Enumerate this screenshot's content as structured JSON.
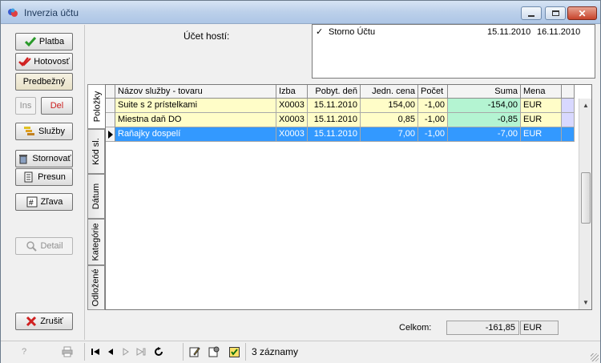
{
  "window": {
    "title": "Inverzia účtu"
  },
  "buttons": {
    "platba": "Platba",
    "hotovost": "Hotovosť",
    "predbezny": "Predbežný",
    "ins": "Ins",
    "del": "Del",
    "sluzby": "Služby",
    "stornovat": "Stornovať",
    "presun": "Presun",
    "zlava": "Zľava",
    "detail": "Detail",
    "zrusit": "Zrušiť"
  },
  "info": {
    "label": "Účet hostí:",
    "entry": {
      "text": "Storno Účtu",
      "date_from": "15.11.2010",
      "date_to": "16.11.2010"
    }
  },
  "tabs": [
    "Položky",
    "Kód sl.",
    "Dátum",
    "Kategórie",
    "Odložené"
  ],
  "grid": {
    "columns": [
      "Názov služby - tovaru",
      "Izba",
      "Pobyt. deň",
      "Jedn. cena",
      "Počet",
      "Suma",
      "Mena"
    ],
    "rows": [
      [
        "Suite s 2 prístelkami",
        "X0003",
        "15.11.2010",
        "154,00",
        "-1,00",
        "-154,00",
        "EUR"
      ],
      [
        "Miestna daň DO",
        "X0003",
        "15.11.2010",
        "0,85",
        "-1,00",
        "-0,85",
        "EUR"
      ],
      [
        "Raňajky dospelí",
        "X0003",
        "15.11.2010",
        "7,00",
        "-1,00",
        "-7,00",
        "EUR"
      ]
    ],
    "selected_row": 2
  },
  "total": {
    "label": "Celkom:",
    "value": "-161,85",
    "currency": "EUR"
  },
  "status": {
    "count_text": "3 záznamy"
  },
  "colors": {
    "row_yellow": "#fffdc8",
    "sum_green": "#b4f4d2",
    "selected": "#3399ff",
    "accent_purple": "#d8d8ff"
  }
}
